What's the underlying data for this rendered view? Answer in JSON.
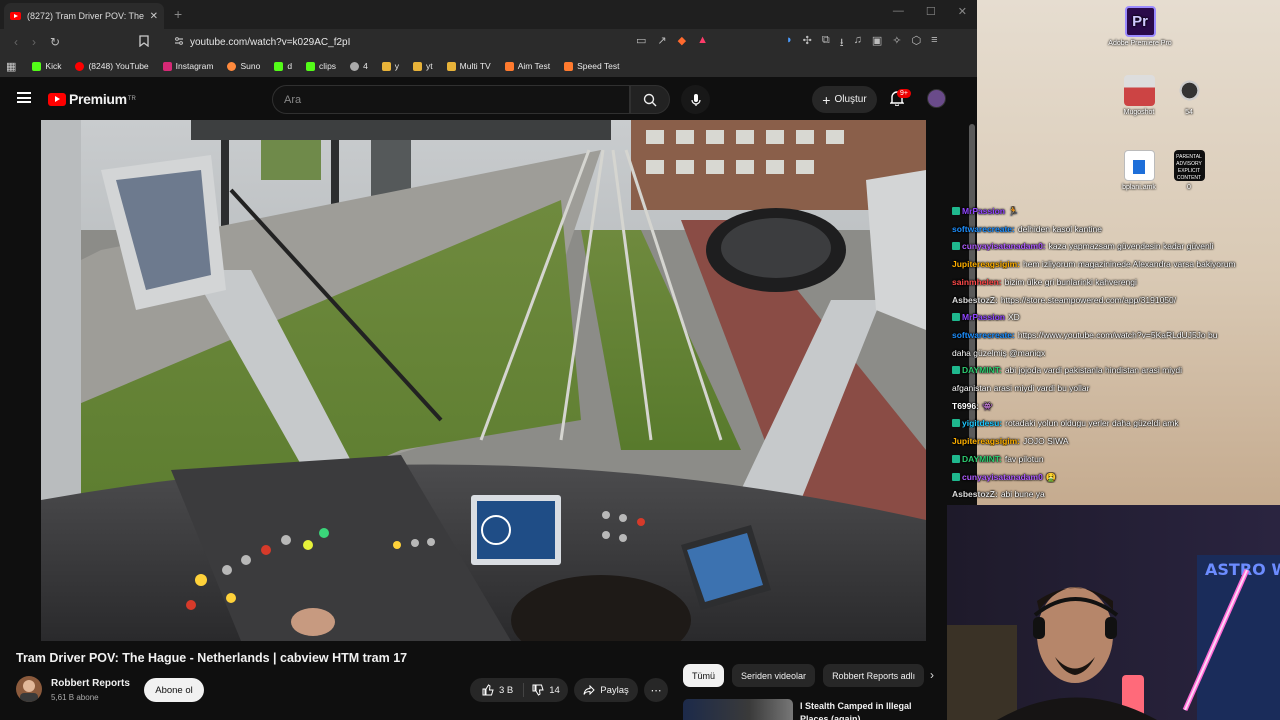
{
  "browser": {
    "tab_title": "(8272) Tram Driver POV: The Hague",
    "url": "youtube.com/watch?v=k029AC_f2pI",
    "bookmarks": [
      {
        "label": "Kick",
        "color": "#53fc18"
      },
      {
        "label": "(8248) YouTube",
        "color": "#ff0000"
      },
      {
        "label": "Instagram",
        "color": "#d62976"
      },
      {
        "label": "Suno",
        "color": "#ff8a3d"
      },
      {
        "label": "d",
        "color": "#53fc18"
      },
      {
        "label": "clips",
        "color": "#53fc18"
      },
      {
        "label": "4",
        "color": "#aaaaaa"
      },
      {
        "label": "y",
        "color": "#e8b339"
      },
      {
        "label": "yt",
        "color": "#e8b339"
      },
      {
        "label": "Multi TV",
        "color": "#e8b339"
      },
      {
        "label": "Aim Test",
        "color": "#ff7a2e"
      },
      {
        "label": "Speed Test",
        "color": "#ff7a2e"
      }
    ]
  },
  "youtube": {
    "logo_text": "Premium",
    "logo_sup": "TR",
    "search_placeholder": "Ara",
    "create_label": "Oluştur",
    "notification_badge": "9+"
  },
  "video": {
    "title": "Tram Driver POV: The Hague - Netherlands | cabview HTM tram 17",
    "channel": "Robbert Reports",
    "subscribers": "5,61 B abone",
    "subscribe_label": "Abone ol",
    "likes": "3 B",
    "dislikes": "14",
    "share_label": "Paylaş"
  },
  "chips": [
    "Tümü",
    "Seriden videolar",
    "Robbert Reports adlı"
  ],
  "recommendation": {
    "title": "I Stealth Camped in Illegal Places (again)"
  },
  "desktop_icons": [
    {
      "label": "Adobe Premiere Pro",
      "glyph": "Pr"
    },
    {
      "label": "Mugoshot"
    },
    {
      "label": "54"
    },
    {
      "label": "bplani.amk"
    },
    {
      "label": "0",
      "glyph": "PARENTAL ADVISORY EXPLICIT CONTENT"
    }
  ],
  "chat": [
    {
      "user": "MrPassion",
      "text": "🏃",
      "color": "#9146ff",
      "badge": true
    },
    {
      "user": "softwarecreate:",
      "text": "delhiden kasol kantine",
      "color": "#1e90ff",
      "badge": false
    },
    {
      "user": "cunyayisatanadam0:",
      "text": "kaza yapmazsam güvendesin kadar güvenli",
      "color": "#b05cff",
      "badge": true
    },
    {
      "user": "Jupitereagsigim:",
      "text": "hem izliyorum magazininede Alexandra varsa bakiyorum",
      "color": "#ffb000",
      "badge": false
    },
    {
      "user": "sainmhelen:",
      "text": "bizim ülke gri bunlarinki kahverengi",
      "color": "#ff4a4a",
      "badge": false
    },
    {
      "user": "AsbestozZ:",
      "text": "https://store.steampowered.com/app/3191050/",
      "color": "#dddddd",
      "badge": false
    },
    {
      "user": "MrPassion",
      "text": "XD",
      "color": "#9146ff",
      "badge": true
    },
    {
      "user": "softwarecreate:",
      "text": "https://www.youtube.com/watch?v=5KaRLdUJ5Jo bu",
      "color": "#1e90ff",
      "badge": false
    },
    {
      "user": "",
      "text": "daha güzelmiş @maniqx",
      "color": "#ffffff",
      "badge": false
    },
    {
      "user": "DAYMINT:",
      "text": "abi jojoda vardi pakistanla hindistan arasi miydi",
      "color": "#2ecc71",
      "badge": true
    },
    {
      "user": "",
      "text": "afganistan arasi miydi vardi bu yollar",
      "color": "#ffffff",
      "badge": false
    },
    {
      "user": "T6996:",
      "text": "👾",
      "color": "#ffffff",
      "badge": false
    },
    {
      "user": "yigitdesu:",
      "text": "rotadaki yolun oldugu yerler daha güzeldi amk",
      "color": "#1ec8ff",
      "badge": true
    },
    {
      "user": "Jupitereagsigim:",
      "text": "JOJO SIWA",
      "color": "#ffb000",
      "badge": false
    },
    {
      "user": "DAYMINT:",
      "text": "fav pilotun",
      "color": "#2ecc71",
      "badge": true
    },
    {
      "user": "cunyayisatanadam0",
      "text": "🤮",
      "color": "#b05cff",
      "badge": true
    },
    {
      "user": "AsbestozZ:",
      "text": "abi bune ya",
      "color": "#dddddd",
      "badge": false
    }
  ],
  "webcam": {
    "sign_text": "ASTRO WORLD"
  }
}
